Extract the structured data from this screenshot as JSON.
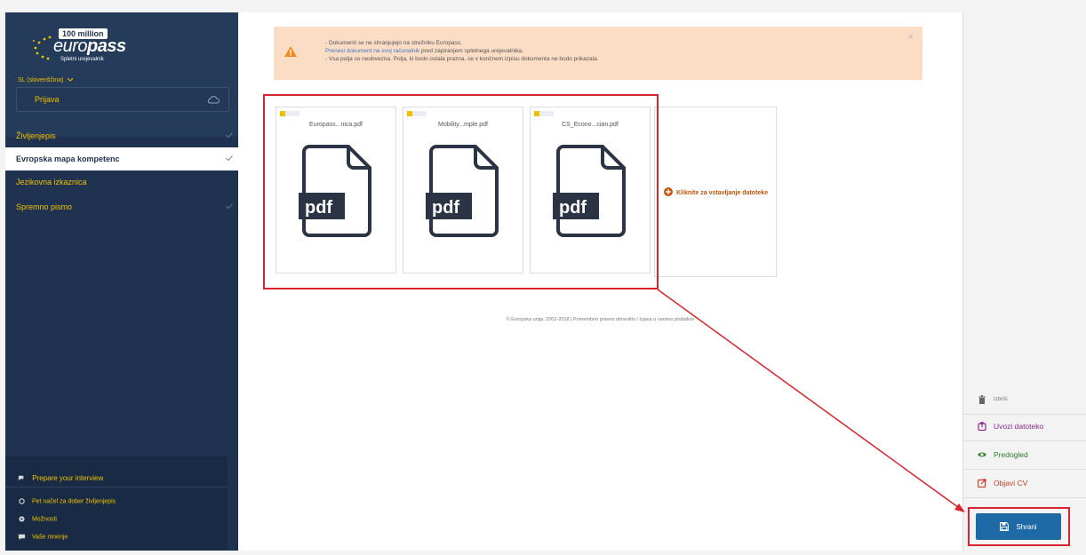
{
  "logo": {
    "badge": "100 million",
    "wordmark_prefix": "euro",
    "wordmark_suffix": "pass",
    "subtitle": "Spletni urejevalnik"
  },
  "language": "SL (slovenščina)",
  "login": {
    "label": "Prijava"
  },
  "nav": [
    {
      "label": "Življenjepis",
      "checked": true
    },
    {
      "label": "Evropska mapa kompetenc",
      "checked": true,
      "active": true
    },
    {
      "label": "Jezikovna izkaznica",
      "checked": false
    },
    {
      "label": "Spremno pismo",
      "checked": true
    }
  ],
  "sidebar_footer": {
    "prepare": "Prepare your interview",
    "tips": "Pet načel za dober življenjepis",
    "options": "Možnosti",
    "feedback": "Vaše mnenje"
  },
  "alert": {
    "line1": "- Dokumenti se ne shranjujejo na strežniku Europass.",
    "line2_link": "Prenesi dokument na svoj računalnik",
    "line2_rest": " pred zapiranjem spletnega urejevalnika.",
    "line3": "- Vsa polja so neobvezna. Polja, ki bodo ostala prazna, se v končnem izpisu dokumenta ne bodo prikazala.",
    "close": "×"
  },
  "files": [
    {
      "name": "Europass...nica.pdf",
      "type_label": "pdf"
    },
    {
      "name": "Mobility...mple.pdf",
      "type_label": "pdf"
    },
    {
      "name": "CS_Econo...cian.pdf",
      "type_label": "pdf"
    }
  ],
  "add_file": {
    "label": "Kliknite za vstavljanje datoteke"
  },
  "footer": {
    "text": "© Evropska unija, 2002-2018 | Pomembno pravno obvestilo / Izjava o varstvu podatkov"
  },
  "actions": {
    "delete": "Izbriši",
    "import": "Uvozi datoteko",
    "preview": "Predogled",
    "publish": "Objavi CV",
    "save": "Shrani"
  },
  "colors": {
    "sidebar": "#1f3350",
    "accent_yellow": "#f0c000",
    "alert_bg": "#fbdcc5",
    "save_button": "#1e6aa6",
    "highlight": "#d9242f"
  }
}
